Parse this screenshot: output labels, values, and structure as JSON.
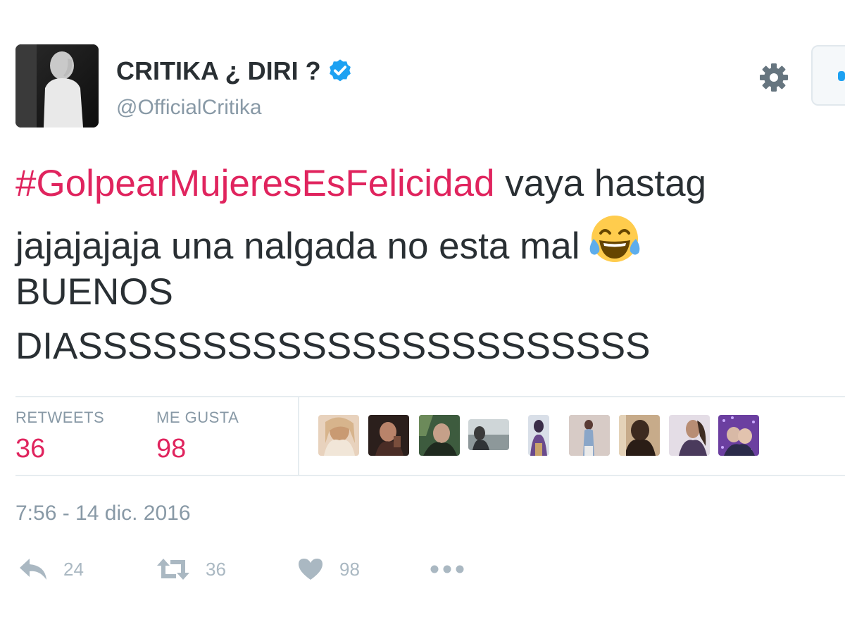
{
  "author": {
    "display_name": "CRITIKA ¿ DIRI ?",
    "handle": "@OfficialCritika",
    "verified": true
  },
  "tweet": {
    "hashtag": "#GolpearMujeresEsFelicidad",
    "line1_rest": " vaya hastag",
    "line2": "jajajajaja una nalgada no esta mal",
    "line3": "BUENOS",
    "line4": "DIASSSSSSSSSSSSSSSSSSSSSSS",
    "emoji": "face-with-tears-of-joy"
  },
  "stats": {
    "retweets_label": "RETWEETS",
    "retweets_value": "36",
    "likes_label": "ME GUSTA",
    "likes_value": "98"
  },
  "timestamp": "7:56 - 14 dic. 2016",
  "actions": {
    "reply_count": "24",
    "retweet_count": "36",
    "like_count": "98"
  },
  "colors": {
    "hashtag": "#e0245e",
    "verified": "#1da1f2",
    "muted": "#8899a6",
    "action_icon": "#aab8c2"
  }
}
